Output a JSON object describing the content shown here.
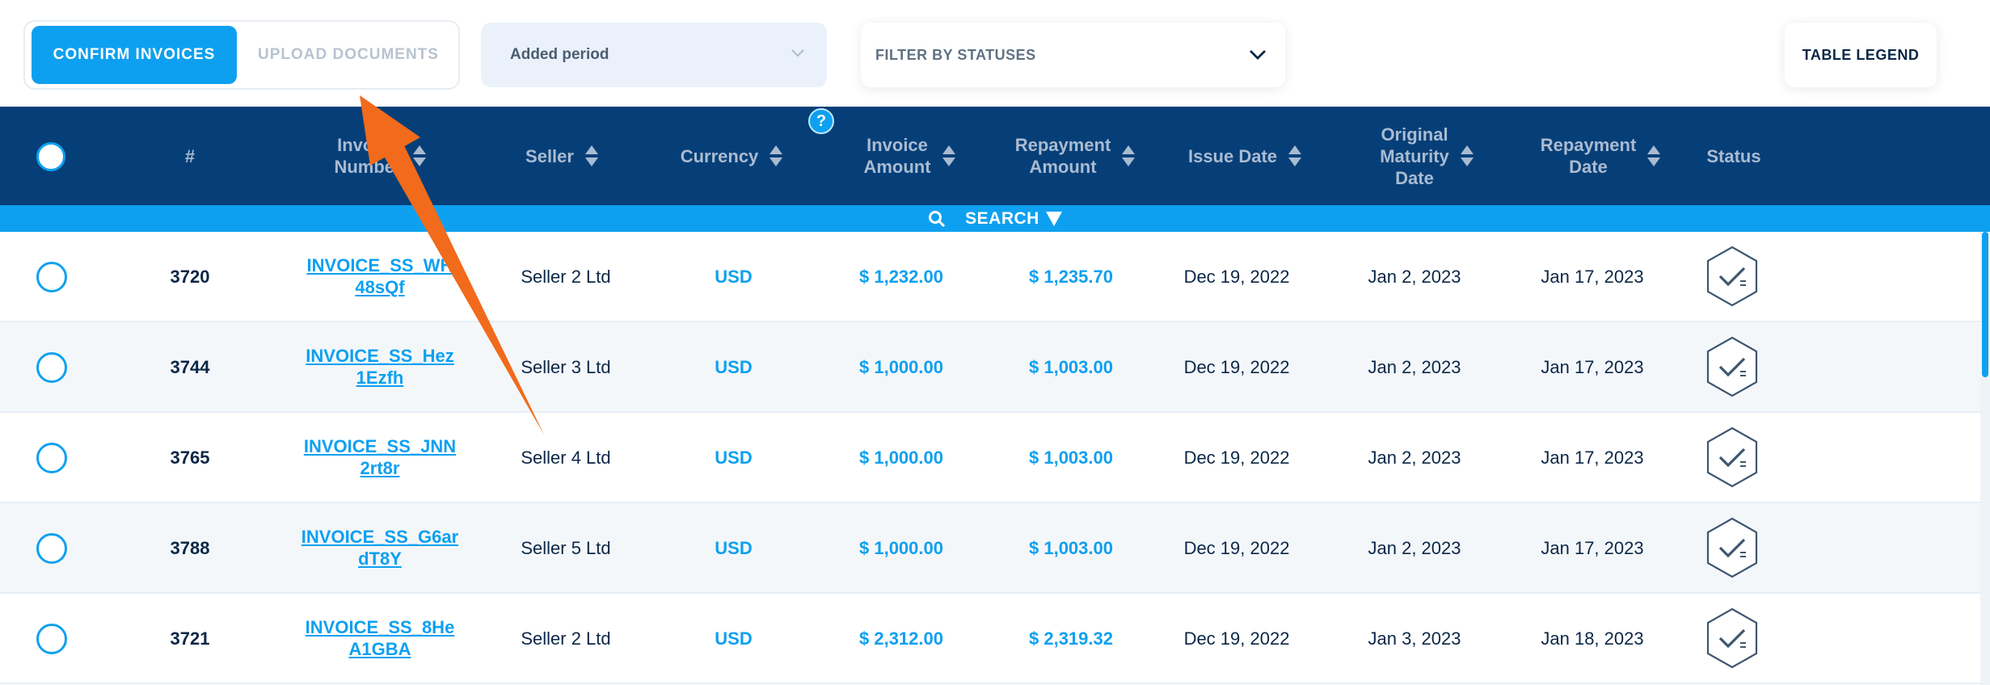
{
  "toolbar": {
    "confirm_label": "CONFIRM INVOICES",
    "upload_label": "UPLOAD DOCUMENTS",
    "period_label": "Added period",
    "statuses_label": "FILTER BY STATUSES",
    "legend_label": "TABLE LEGEND"
  },
  "header": {
    "num": "#",
    "invoice_number_1": "Invoice",
    "invoice_number_2": "Number",
    "seller": "Seller",
    "currency": "Currency",
    "invoice_amount_1": "Invoice",
    "invoice_amount_2": "Amount",
    "repayment_amount_1": "Repayment",
    "repayment_amount_2": "Amount",
    "issue_date": "Issue Date",
    "orig_maturity_1": "Original",
    "orig_maturity_2": "Maturity",
    "orig_maturity_3": "Date",
    "repayment_date_1": "Repayment",
    "repayment_date_2": "Date",
    "status": "Status",
    "help": "?"
  },
  "search": {
    "label": "SEARCH"
  },
  "rows": [
    {
      "num": "3720",
      "inv1": "INVOICE_SS_WH",
      "inv2": "48sQf",
      "seller": "Seller 2 Ltd",
      "currency": "USD",
      "invoice_amount": "$ 1,232.00",
      "repayment_amount": "$ 1,235.70",
      "issue_date": "Dec 19, 2022",
      "maturity_date": "Jan 2, 2023",
      "repayment_date": "Jan 17, 2023"
    },
    {
      "num": "3744",
      "inv1": "INVOICE_SS_Hez",
      "inv2": "1Ezfh",
      "seller": "Seller 3 Ltd",
      "currency": "USD",
      "invoice_amount": "$ 1,000.00",
      "repayment_amount": "$ 1,003.00",
      "issue_date": "Dec 19, 2022",
      "maturity_date": "Jan 2, 2023",
      "repayment_date": "Jan 17, 2023"
    },
    {
      "num": "3765",
      "inv1": "INVOICE_SS_JNN",
      "inv2": "2rt8r",
      "seller": "Seller 4 Ltd",
      "currency": "USD",
      "invoice_amount": "$ 1,000.00",
      "repayment_amount": "$ 1,003.00",
      "issue_date": "Dec 19, 2022",
      "maturity_date": "Jan 2, 2023",
      "repayment_date": "Jan 17, 2023"
    },
    {
      "num": "3788",
      "inv1": "INVOICE_SS_G6ar",
      "inv2": "dT8Y",
      "seller": "Seller 5 Ltd",
      "currency": "USD",
      "invoice_amount": "$ 1,000.00",
      "repayment_amount": "$ 1,003.00",
      "issue_date": "Dec 19, 2022",
      "maturity_date": "Jan 2, 2023",
      "repayment_date": "Jan 17, 2023"
    },
    {
      "num": "3721",
      "inv1": "INVOICE_SS_8He",
      "inv2": "A1GBA",
      "seller": "Seller 2 Ltd",
      "currency": "USD",
      "invoice_amount": "$ 2,312.00",
      "repayment_amount": "$ 2,319.32",
      "issue_date": "Dec 19, 2022",
      "maturity_date": "Jan 3, 2023",
      "repayment_date": "Jan 18, 2023"
    }
  ],
  "icons": {
    "status": "status-confirm-icon",
    "search": "search-icon",
    "chevron": "chevron-down-icon"
  },
  "colors": {
    "accent": "#0ea0f0",
    "header_bg": "#063f78",
    "annotation_arrow": "#f26a1b"
  }
}
